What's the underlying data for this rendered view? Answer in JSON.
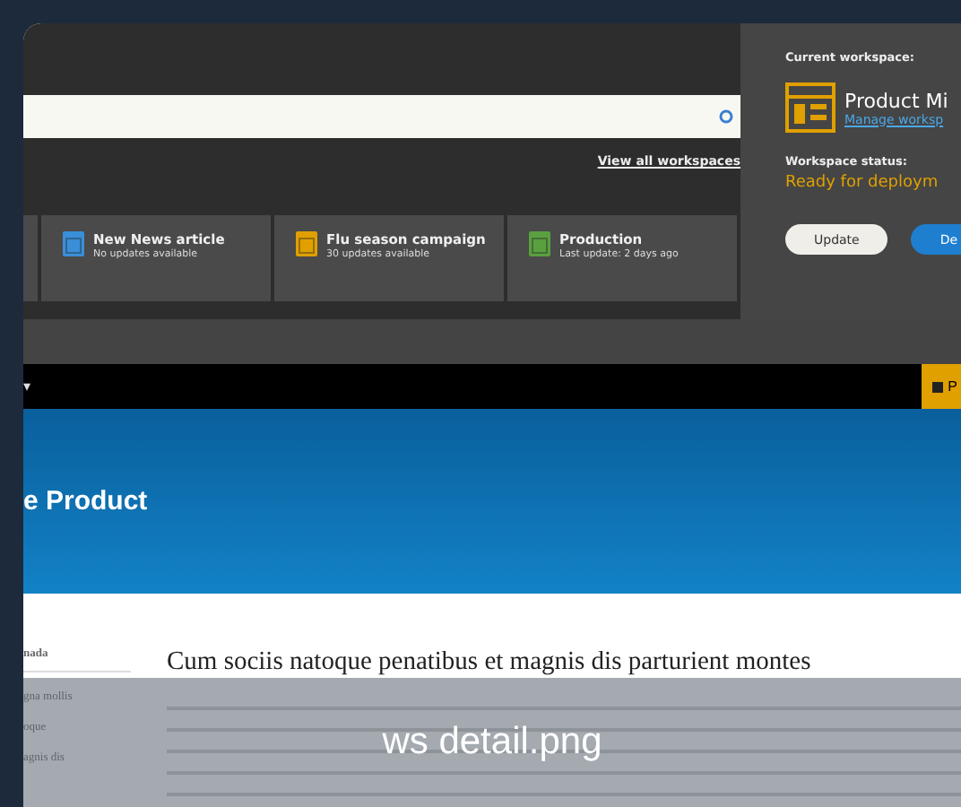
{
  "file_name": "ws detail.png",
  "view_all_link": "View all workspaces",
  "workspaces": [
    {
      "name": "New News article",
      "status": "No updates available",
      "color": "#3a8fd8"
    },
    {
      "name": "Flu season campaign",
      "status": "30 updates available",
      "color": "#e0a000"
    },
    {
      "name": "Production",
      "status": "Last update: 2 days ago",
      "color": "#5aa040"
    }
  ],
  "current_workspace": {
    "label": "Current workspace:",
    "name": "Product Mi",
    "manage_link": "Manage worksp",
    "status_label": "Workspace status:",
    "status": "Ready for deploym"
  },
  "buttons": [
    {
      "label": "Update",
      "kind": "secondary"
    },
    {
      "label": "De",
      "kind": "primary"
    }
  ],
  "toolbar": {
    "caret": "▾",
    "button": "P"
  },
  "site": {
    "title": "e Product",
    "sidebar": [
      "nada",
      "gna mollis",
      "oque",
      "agnis dis"
    ],
    "article_title": "Cum sociis natoque penatibus et magnis dis parturient montes"
  }
}
